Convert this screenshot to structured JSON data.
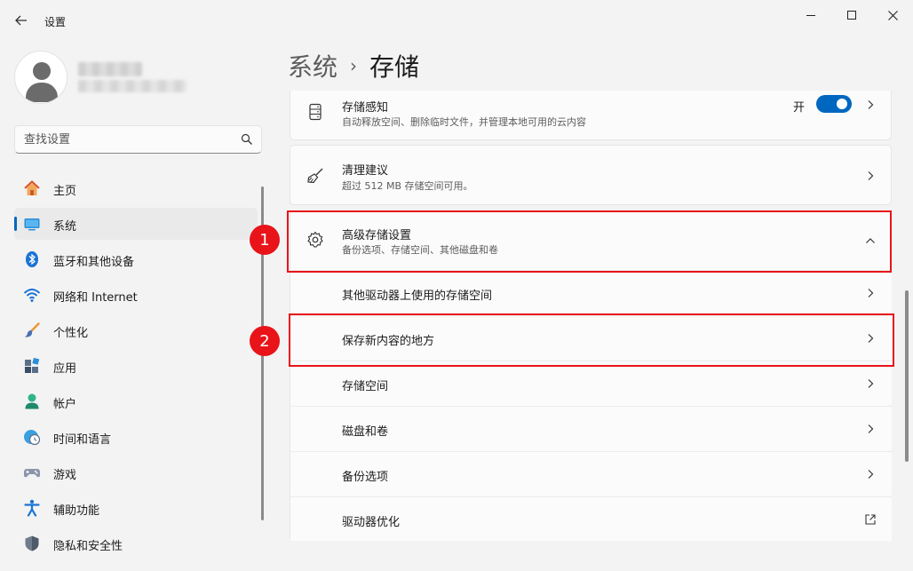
{
  "window": {
    "title": "设置"
  },
  "search": {
    "placeholder": "查找设置"
  },
  "nav": {
    "items": [
      {
        "label": "主页",
        "icon": "home-icon"
      },
      {
        "label": "系统",
        "icon": "system-icon",
        "active": true
      },
      {
        "label": "蓝牙和其他设备",
        "icon": "bluetooth-icon"
      },
      {
        "label": "网络和 Internet",
        "icon": "wifi-icon"
      },
      {
        "label": "个性化",
        "icon": "brush-icon"
      },
      {
        "label": "应用",
        "icon": "apps-icon"
      },
      {
        "label": "帐户",
        "icon": "account-icon"
      },
      {
        "label": "时间和语言",
        "icon": "clock-globe-icon"
      },
      {
        "label": "游戏",
        "icon": "gamepad-icon"
      },
      {
        "label": "辅助功能",
        "icon": "accessibility-icon"
      },
      {
        "label": "隐私和安全性",
        "icon": "shield-icon"
      }
    ]
  },
  "header": {
    "parent": "系统",
    "separator": "›",
    "current": "存储"
  },
  "storage_sense": {
    "title": "存储感知",
    "desc": "自动释放空间、删除临时文件，并管理本地可用的云内容",
    "toggle_label": "开",
    "toggle_on": true
  },
  "cleanup": {
    "title": "清理建议",
    "desc": "超过 512 MB 存储空间可用。"
  },
  "advanced": {
    "title": "高级存储设置",
    "desc": "备份选项、存储空间、其他磁盘和卷",
    "items": [
      {
        "label": "其他驱动器上使用的存储空间"
      },
      {
        "label": "保存新内容的地方"
      },
      {
        "label": "存储空间"
      },
      {
        "label": "磁盘和卷"
      },
      {
        "label": "备份选项"
      },
      {
        "label": "驱动器优化",
        "external": true
      }
    ]
  },
  "annotations": {
    "badge1": "1",
    "badge2": "2",
    "color": "#e8141a"
  },
  "colors": {
    "accent": "#0067c0",
    "background": "#f3f3f3",
    "card": "#fbfbfb"
  }
}
